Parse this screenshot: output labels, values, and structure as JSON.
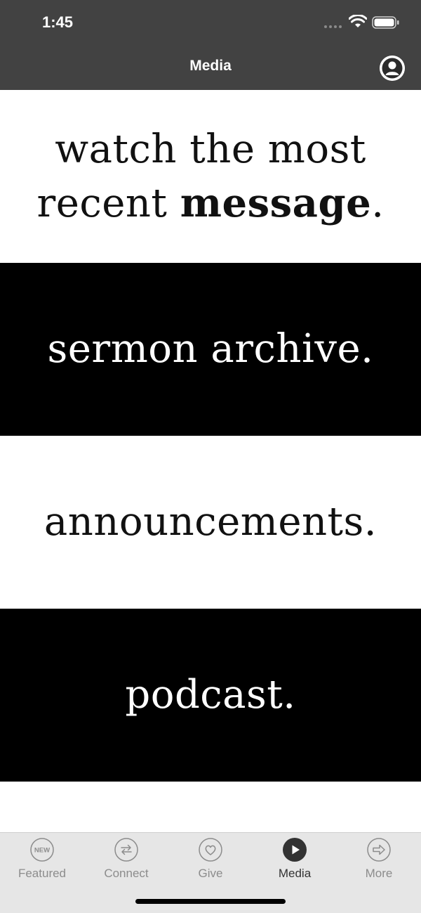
{
  "status_bar": {
    "time": "1:45"
  },
  "nav": {
    "title": "Media"
  },
  "panels": {
    "watch": {
      "line1": "watch the most",
      "line2_regular": "recent ",
      "line2_bold": "message",
      "line2_end": "."
    },
    "sermon_archive": "sermon archive.",
    "announcements": "announcements.",
    "podcast": "podcast."
  },
  "tabs": [
    {
      "label": "Featured",
      "icon": "new-badge-icon",
      "badge": "NEW"
    },
    {
      "label": "Connect",
      "icon": "connect-arrows-icon"
    },
    {
      "label": "Give",
      "icon": "heart-icon"
    },
    {
      "label": "Media",
      "icon": "play-icon",
      "active": true
    },
    {
      "label": "More",
      "icon": "arrow-right-icon"
    }
  ],
  "colors": {
    "header_bg": "#424242",
    "tabbar_bg": "#e6e6e6",
    "active_tab": "#333333",
    "inactive_tab": "#8c8c8c"
  }
}
